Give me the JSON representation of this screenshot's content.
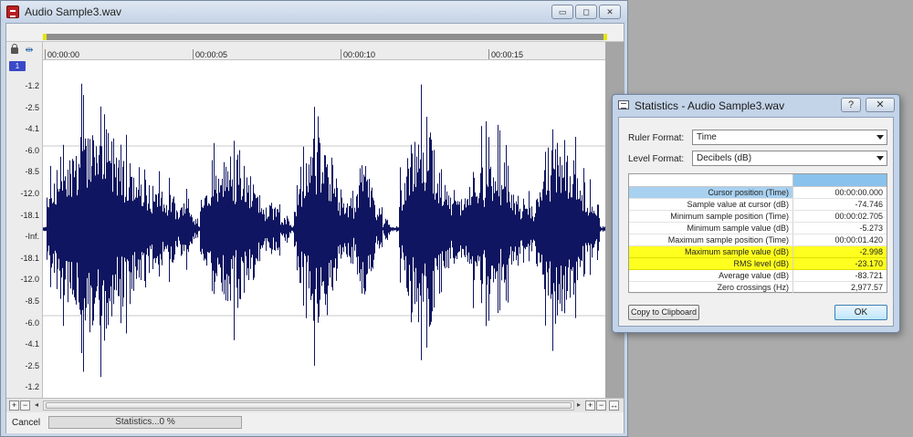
{
  "main_window": {
    "title": "Audio Sample3.wav",
    "min_glyph": "▭",
    "max_glyph": "◻",
    "close_glyph": "✕",
    "channel_badge": "1",
    "snap_glyph": "⇹"
  },
  "time_ruler": {
    "labels": [
      "00:00:00",
      "00:00:05",
      "00:00:10",
      "00:00:15"
    ]
  },
  "level_scale": {
    "labels": [
      "-1.2",
      "-2.5",
      "-4.1",
      "-6.0",
      "-8.5",
      "-12.0",
      "-18.1",
      "-Inf.",
      "-18.1",
      "-12.0",
      "-8.5",
      "-6.0",
      "-4.1",
      "-2.5",
      "-1.2"
    ]
  },
  "waveform": {
    "color": "#0f1560",
    "duration_seconds": 19
  },
  "bottom_controls": {
    "plus": "+",
    "minus": "−",
    "left_arrow": "◂",
    "right_arrow": "▸",
    "full_glyph": "↔"
  },
  "status_bar": {
    "cancel_label": "Cancel",
    "progress_text": "Statistics...0 %",
    "progress_percent": 0
  },
  "stats_dialog": {
    "title": "Statistics - Audio Sample3.wav",
    "help_glyph": "?",
    "close_glyph": "✕",
    "ruler_format_label": "Ruler Format:",
    "ruler_format_value": "Time",
    "level_format_label": "Level Format:",
    "level_format_value": "Decibels (dB)",
    "rows": [
      {
        "label": "Cursor position (Time)",
        "value": "00:00:00.000"
      },
      {
        "label": "Sample value at cursor (dB)",
        "value": "-74.746"
      },
      {
        "label": "Minimum sample position (Time)",
        "value": "00:00:02.705"
      },
      {
        "label": "Minimum sample value (dB)",
        "value": "-5.273"
      },
      {
        "label": "Maximum sample position (Time)",
        "value": "00:00:01.420"
      },
      {
        "label": "Maximum sample value (dB)",
        "value": "-2.998"
      },
      {
        "label": "RMS level (dB)",
        "value": "-23.170"
      },
      {
        "label": "Average value (dB)",
        "value": "-83.721"
      },
      {
        "label": "Zero crossings (Hz)",
        "value": "2,977.57"
      }
    ],
    "highlight_color": "#ffff1f",
    "copy_button_label": "Copy to Clipboard",
    "ok_button_label": "OK"
  }
}
